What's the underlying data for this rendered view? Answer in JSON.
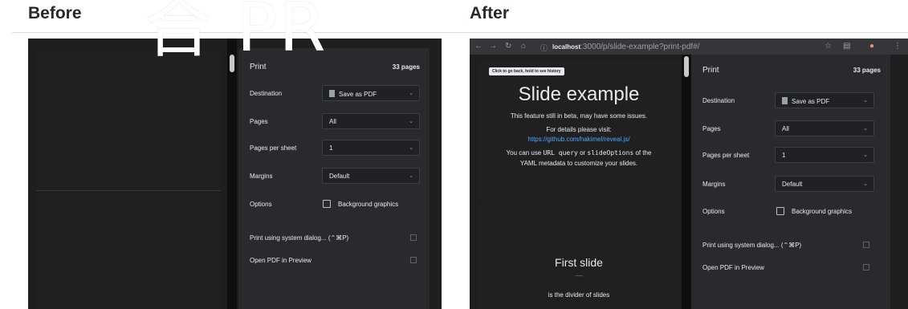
{
  "labels": {
    "before": "Before",
    "after": "After"
  },
  "watermark": "合 PR",
  "print_panel": {
    "title": "Print",
    "pages_count": "33 pages",
    "destination_label": "Destination",
    "destination_value": "Save as PDF",
    "pages_label": "Pages",
    "pages_value": "All",
    "pages_per_sheet_label": "Pages per sheet",
    "pages_per_sheet_value": "1",
    "margins_label": "Margins",
    "margins_value": "Default",
    "options_label": "Options",
    "background_graphics_label": "Background graphics",
    "system_dialog": "Print using system dialog... (⌃⌘P)",
    "open_pdf": "Open PDF in Preview"
  },
  "browser": {
    "url_host": "localhost",
    "url_rest": ":3000/p/slide-example?print-pdf#/"
  },
  "slide": {
    "hint": "Click to go back, hold to see history",
    "title": "Slide example",
    "line1": "This feature still in beta, may have some issues.",
    "line2": "For details please visit:",
    "link": "https://github.com/hakimel/reveal.js/",
    "line3_a": "You can use ",
    "line3_code1": "URL query",
    "line3_b": " or ",
    "line3_code2": "slideOptions",
    "line3_c": " of the",
    "line4": "YAML metadata to customize your slides.",
    "second_title": "First slide",
    "divider": "----",
    "divider_caption": "is the divider of slides"
  }
}
